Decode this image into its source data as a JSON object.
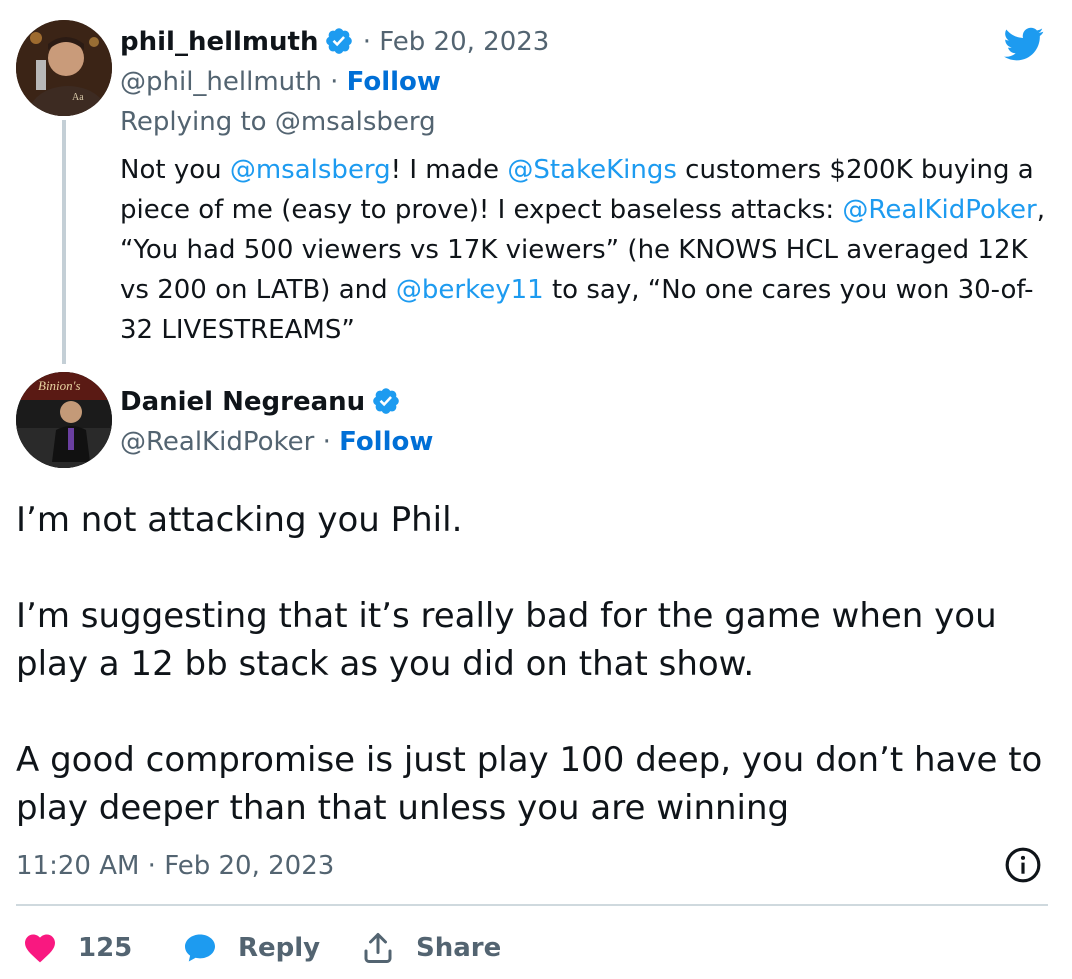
{
  "parent": {
    "display_name": "phil_hellmuth",
    "date": "Feb 20, 2023",
    "handle": "@phil_hellmuth",
    "follow_label": "Follow",
    "replying_to_prefix": "Replying to",
    "replying_to_handle": "@msalsberg",
    "body": {
      "t1": "Not you ",
      "m1": "@msalsberg",
      "t2": "! I made ",
      "m2": "@StakeKings",
      "t3": " customers $200K buying a piece of me (easy to prove)! I expect baseless attacks: ",
      "m3": "@RealKidPoker",
      "t4": ", “You had 500 viewers vs 17K viewers” (he KNOWS HCL averaged 12K vs 200 on LATB) and ",
      "m4": "@berkey11",
      "t5": " to say, “No one cares you won 30-of-32 LIVESTREAMS”"
    }
  },
  "main": {
    "display_name": "Daniel Negreanu",
    "handle": "@RealKidPoker",
    "follow_label": "Follow",
    "paragraphs": [
      "I’m not attacking you Phil.",
      "I’m suggesting that it’s really bad for the game when you play a 12 bb stack as you did on that show.",
      "A good compromise is just play 100 deep, you don’t have to play deeper than that unless you are winning"
    ],
    "timestamp": "11:20 AM · Feb 20, 2023"
  },
  "actions": {
    "likes_count": "125",
    "reply_label": "Reply",
    "share_label": "Share"
  },
  "icons": {
    "brand": "twitter-bird-icon",
    "verified": "verified-badge-icon",
    "info": "info-icon",
    "like": "heart-icon",
    "reply": "reply-bubble-icon",
    "share": "share-icon"
  },
  "colors": {
    "link": "#1d9bf0",
    "follow": "#006fd6",
    "muted": "#536471",
    "heart": "#f91880"
  }
}
